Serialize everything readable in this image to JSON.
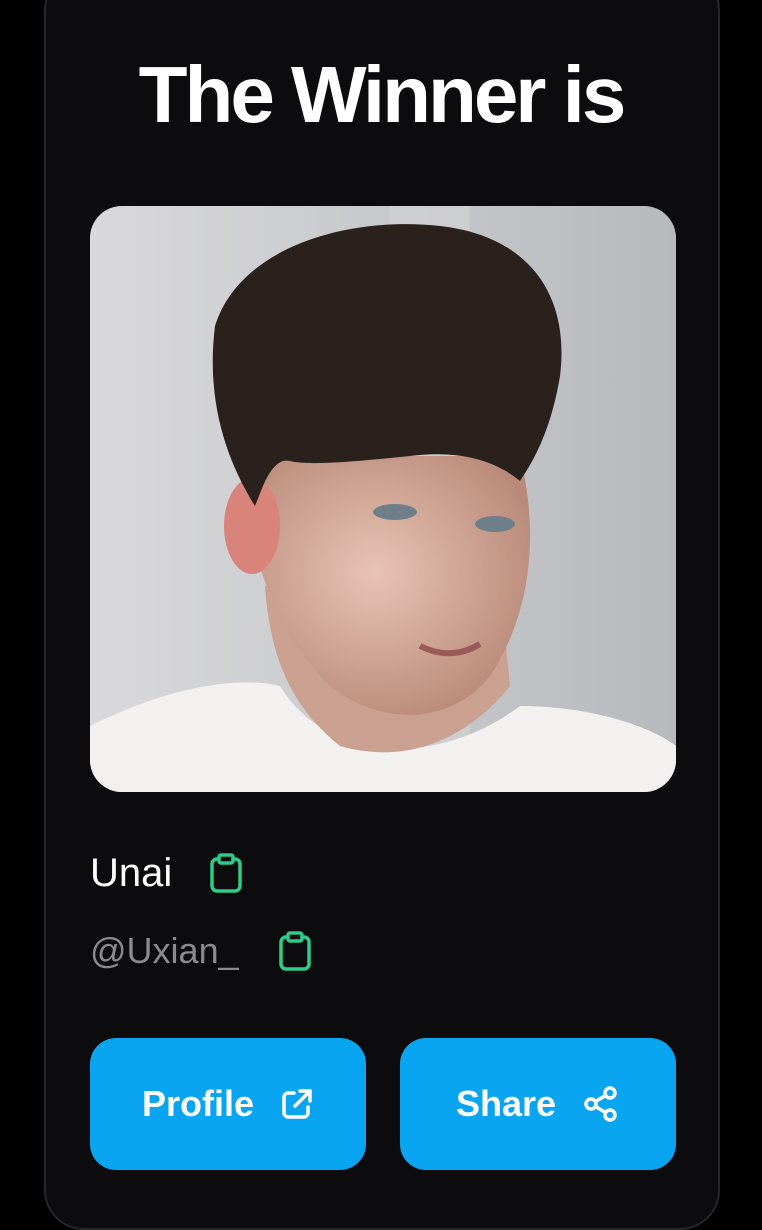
{
  "heading": "The Winner is",
  "winner": {
    "name": "Unai",
    "handle": "@Uxian_"
  },
  "actions": {
    "profile_label": "Profile",
    "share_label": "Share"
  },
  "icons": {
    "copy": "clipboard-icon",
    "profile": "external-link-icon",
    "share": "share-icon"
  },
  "colors": {
    "background": "#000000",
    "card": "#0c0c0f",
    "accent_button": "#0aa5f0",
    "copy_icon": "#2ecc8a",
    "handle_text": "#8a8a8f"
  }
}
